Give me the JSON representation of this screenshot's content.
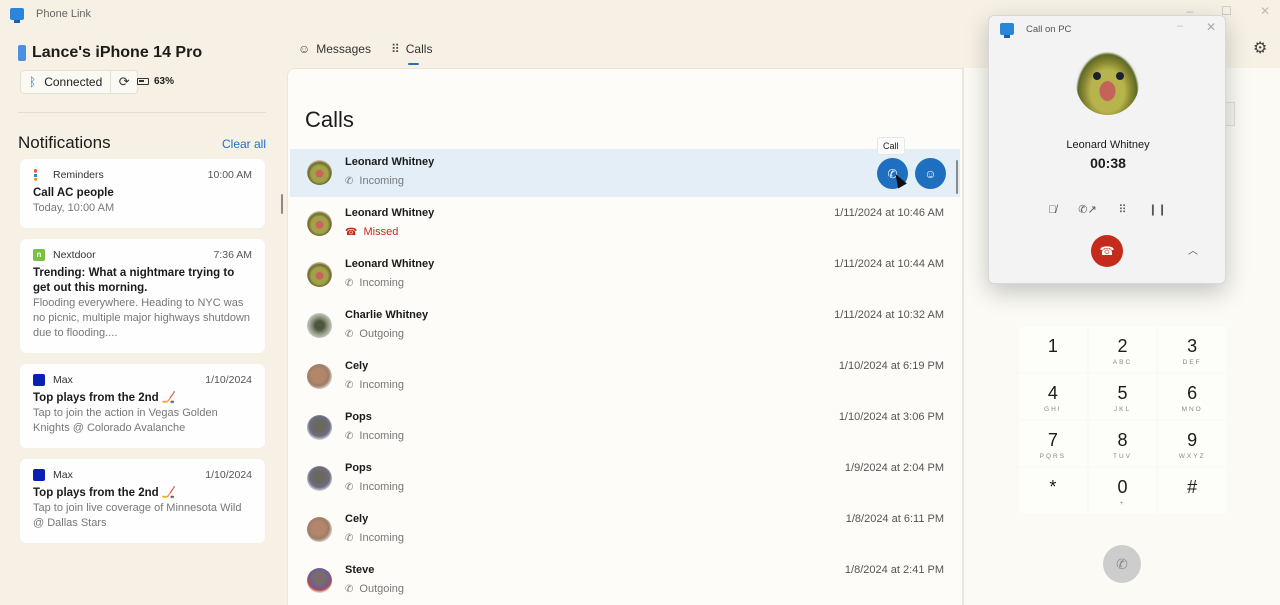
{
  "app": {
    "title": "Phone Link",
    "icon": "phone-link-logo"
  },
  "window_controls": [
    "minimize",
    "maximize",
    "close"
  ],
  "device": {
    "name": "Lance's iPhone 14 Pro",
    "connection": "Connected",
    "battery": "63%",
    "icons": {
      "bluetooth": "ᛒ",
      "sync": "⟳"
    }
  },
  "notifications": {
    "title": "Notifications",
    "clear_all": "Clear all",
    "items": [
      {
        "app": "Reminders",
        "time": "10:00 AM",
        "head": "Call AC people",
        "body": "Today, 10:00 AM",
        "icon": "reminders-icon"
      },
      {
        "app": "Nextdoor",
        "time": "7:36 AM",
        "head": "Trending: What a nightmare trying to get out  this morning.",
        "body": "Flooding everywhere. Heading to NYC was no picnic, multiple major highways shutdown due to flooding....",
        "icon": "nextdoor-icon"
      },
      {
        "app": "Max",
        "time": "1/10/2024",
        "head": "Top plays from the 2nd 🏒",
        "body": "Tap to join the action in Vegas Golden Knights @ Colorado Avalanche",
        "icon": "max-icon"
      },
      {
        "app": "Max",
        "time": "1/10/2024",
        "head": "Top plays from the 2nd 🏒",
        "body": "Tap to join live coverage of Minnesota Wild @ Dallas Stars",
        "icon": "max-icon"
      }
    ]
  },
  "tabs": [
    {
      "label": "Messages",
      "icon": "☺",
      "active": false
    },
    {
      "label": "Calls",
      "icon": "⠿",
      "active": true
    }
  ],
  "calls": {
    "title": "Calls",
    "tooltip": "Call",
    "items": [
      {
        "name": "Leonard Whitney",
        "type": "Incoming",
        "time": "",
        "selected": true,
        "avatar": "frog"
      },
      {
        "name": "Leonard Whitney",
        "type": "Missed",
        "time": "1/11/2024 at 10:46 AM",
        "avatar": "frog"
      },
      {
        "name": "Leonard Whitney",
        "type": "Incoming",
        "time": "1/11/2024 at 10:44 AM",
        "avatar": "frog"
      },
      {
        "name": "Charlie Whitney",
        "type": "Outgoing",
        "time": "1/11/2024 at 10:32 AM",
        "avatar": "charlie"
      },
      {
        "name": "Cely",
        "type": "Incoming",
        "time": "1/10/2024 at 6:19 PM",
        "avatar": "cely"
      },
      {
        "name": "Pops",
        "type": "Incoming",
        "time": "1/10/2024 at 3:06 PM",
        "avatar": "pops"
      },
      {
        "name": "Pops",
        "type": "Incoming",
        "time": "1/9/2024 at 2:04 PM",
        "avatar": "pops"
      },
      {
        "name": "Cely",
        "type": "Incoming",
        "time": "1/8/2024 at 6:11 PM",
        "avatar": "cely"
      },
      {
        "name": "Steve",
        "type": "Outgoing",
        "time": "1/8/2024 at 2:41 PM",
        "avatar": "steve"
      }
    ]
  },
  "keypad": [
    {
      "digit": "1",
      "letters": ""
    },
    {
      "digit": "2",
      "letters": "ABC"
    },
    {
      "digit": "3",
      "letters": "DEF"
    },
    {
      "digit": "4",
      "letters": "GHI"
    },
    {
      "digit": "5",
      "letters": "JKL"
    },
    {
      "digit": "6",
      "letters": "MNO"
    },
    {
      "digit": "7",
      "letters": "PQRS"
    },
    {
      "digit": "8",
      "letters": "TUV"
    },
    {
      "digit": "9",
      "letters": "WXYZ"
    },
    {
      "digit": "*",
      "letters": ""
    },
    {
      "digit": "0",
      "letters": "+"
    },
    {
      "digit": "#",
      "letters": ""
    }
  ],
  "call_popup": {
    "title": "Call on PC",
    "contact": "Leonard Whitney",
    "timer": "00:38",
    "controls": [
      "mute",
      "transfer",
      "keypad",
      "hold"
    ]
  },
  "colors": {
    "accent": "#1f6fc0",
    "end_call": "#c42b1c",
    "missed": "#c42b1c",
    "selected_row": "#e3eef7"
  }
}
